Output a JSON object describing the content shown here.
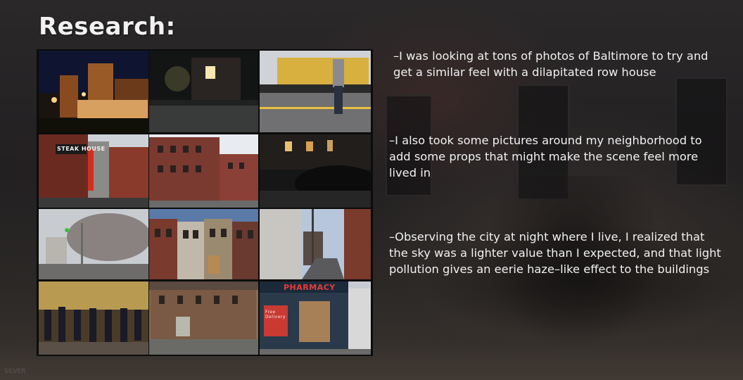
{
  "slide": {
    "title": "Research:",
    "watermark": "SILVER"
  },
  "notes": [
    "–I was looking at tons of photos of Baltimore to try and\nget a similar feel with a dilapitated row house",
    "–I also took some pictures around my neighborhood to\nadd some props that might make the scene feel more\nlived in",
    "–Observing the city at night where I live, I realized that\nthe sky was a lighter value than I expected, and that light\npollution gives an eerie haze–like effect to the buildings"
  ],
  "collage": {
    "signs": {
      "steak_house": "STEAK HOUSE",
      "pharmacy": "PHARMACY",
      "free_delivery": "Free Delivery"
    },
    "photos": [
      {
        "subject": "night-skyline"
      },
      {
        "subject": "night-row-house"
      },
      {
        "subject": "street-crowd-hoodie"
      },
      {
        "subject": "steak-house-street"
      },
      {
        "subject": "brick-warehouse"
      },
      {
        "subject": "night-porch-car"
      },
      {
        "subject": "smoke-intersection"
      },
      {
        "subject": "row-houses"
      },
      {
        "subject": "narrow-street"
      },
      {
        "subject": "riot-police"
      },
      {
        "subject": "corner-building"
      },
      {
        "subject": "boarded-pharmacy"
      }
    ]
  }
}
